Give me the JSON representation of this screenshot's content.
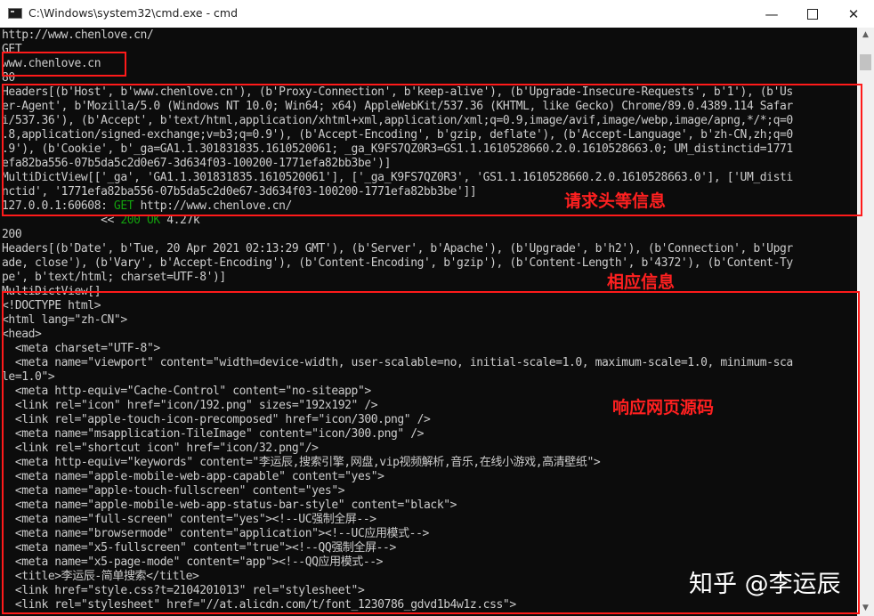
{
  "window": {
    "title": "C:\\Windows\\system32\\cmd.exe - cmd",
    "minimize": "—",
    "close": "✕"
  },
  "terminal": {
    "lines": [
      "http://www.chenlove.cn/",
      "GET",
      "www.chenlove.cn",
      "80",
      "Headers[(b'Host', b'www.chenlove.cn'), (b'Proxy-Connection', b'keep-alive'), (b'Upgrade-Insecure-Requests', b'1'), (b'Us",
      "er-Agent', b'Mozilla/5.0 (Windows NT 10.0; Win64; x64) AppleWebKit/537.36 (KHTML, like Gecko) Chrome/89.0.4389.114 Safar",
      "i/537.36'), (b'Accept', b'text/html,application/xhtml+xml,application/xml;q=0.9,image/avif,image/webp,image/apng,*/*;q=0",
      ".8,application/signed-exchange;v=b3;q=0.9'), (b'Accept-Encoding', b'gzip, deflate'), (b'Accept-Language', b'zh-CN,zh;q=0",
      ".9'), (b'Cookie', b'_ga=GA1.1.301831835.1610520061; _ga_K9FS7QZ0R3=GS1.1.1610528660.2.0.1610528663.0; UM_distinctid=1771",
      "efa82ba556-07b5da5c2d0e67-3d634f03-100200-1771efa82bb3be')]",
      "MultiDictView[['_ga', 'GA1.1.301831835.1610520061'], ['_ga_K9FS7QZ0R3', 'GS1.1.1610528660.2.0.1610528663.0'], ['UM_disti",
      "nctid', '1771efa82ba556-07b5da5c2d0e67-3d634f03-100200-1771efa82bb3be']]",
      "127.0.0.1:60608: GET http://www.chenlove.cn/",
      "               << 200 OK 4.27k",
      "200",
      "Headers[(b'Date', b'Tue, 20 Apr 2021 02:13:29 GMT'), (b'Server', b'Apache'), (b'Upgrade', b'h2'), (b'Connection', b'Upgr",
      "ade, close'), (b'Vary', b'Accept-Encoding'), (b'Content-Encoding', b'gzip'), (b'Content-Length', b'4372'), (b'Content-Ty",
      "pe', b'text/html; charset=UTF-8')]",
      "MultiDictView[]",
      "<!DOCTYPE html>",
      "<html lang=\"zh-CN\">",
      "<head>",
      "  <meta charset=\"UTF-8\">",
      "  <meta name=\"viewport\" content=\"width=device-width, user-scalable=no, initial-scale=1.0, maximum-scale=1.0, minimum-sca",
      "le=1.0\">",
      "  <meta http-equiv=\"Cache-Control\" content=\"no-siteapp\">",
      "  <link rel=\"icon\" href=\"icon/192.png\" sizes=\"192x192\" />",
      "  <link rel=\"apple-touch-icon-precomposed\" href=\"icon/300.png\" />",
      "  <meta name=\"msapplication-TileImage\" content=\"icon/300.png\" />",
      "  <link rel=\"shortcut icon\" href=\"icon/32.png\"/>",
      "  <meta http-equiv=\"keywords\" content=\"李运辰,搜索引擎,网盘,vip视频解析,音乐,在线小游戏,高清壁纸\">",
      "  <meta name=\"apple-mobile-web-app-capable\" content=\"yes\">",
      "  <meta name=\"apple-touch-fullscreen\" content=\"yes\">",
      "  <meta name=\"apple-mobile-web-app-status-bar-style\" content=\"black\">",
      "  <meta name=\"full-screen\" content=\"yes\"><!--UC强制全屏-->",
      "  <meta name=\"browsermode\" content=\"application\"><!--UC应用模式-->",
      "  <meta name=\"x5-fullscreen\" content=\"true\"><!--QQ强制全屏-->",
      "  <meta name=\"x5-page-mode\" content=\"app\"><!--QQ应用模式-->",
      "  <title>李运辰-简单搜索</title>",
      "  <link href=\"style.css?t=2104201013\" rel=\"stylesheet\">",
      "  <link rel=\"stylesheet\" href=\"//at.alicdn.com/t/font_1230786_gdvd1b4w1z.css\">"
    ],
    "log_line": {
      "prefix": "127.0.0.1:60608: ",
      "method": "GET",
      "url": " http://www.chenlove.cn/"
    },
    "status_line": {
      "indent": "               << ",
      "status": "200 OK",
      "size": " 4.27k"
    }
  },
  "annotations": {
    "request": "请求头等信息",
    "response": "相应信息",
    "source": "响应网页源码"
  },
  "watermark": "知乎 @李运辰",
  "colors": {
    "background": "#0c0c0c",
    "text": "#cccccc",
    "green": "#13a10e",
    "highlight": "#ff1a1a"
  }
}
